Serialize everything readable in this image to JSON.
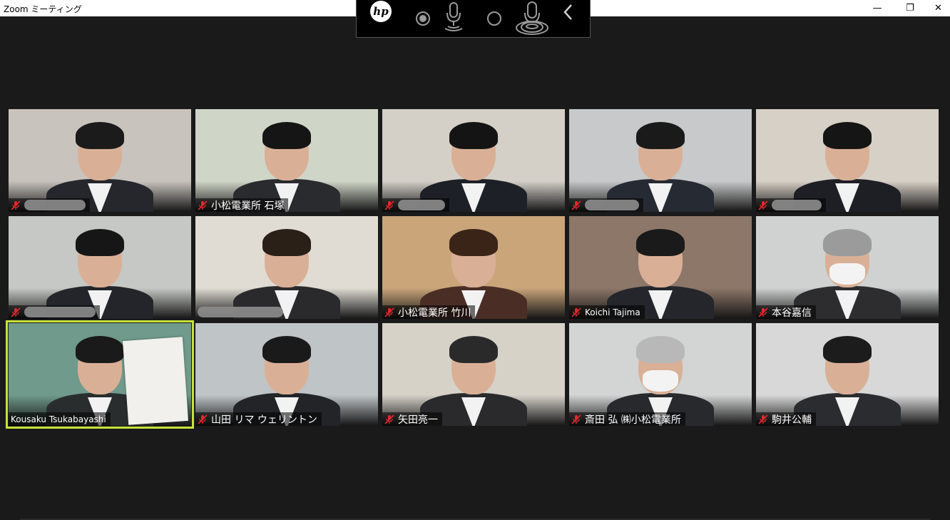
{
  "window": {
    "title": "Zoom ミーティング",
    "minimize_glyph": "—",
    "maximize_glyph": "❐",
    "close_glyph": "✕"
  },
  "hp_toolbar": {
    "logo_text": "hp",
    "buttons": [
      "record-dot-icon",
      "microphone-icon",
      "circle-icon",
      "microphone-broadcast-icon",
      "chevron-left-icon"
    ]
  },
  "participants": [
    {
      "name": "",
      "muted": true,
      "active": false,
      "wall": "#c9c3bd",
      "hair": "#1b1b1b",
      "body": "#25272c"
    },
    {
      "name": "小松電業所 石塚",
      "muted": true,
      "active": false,
      "wall": "#cfd6c8",
      "hair": "#151515",
      "body": "#2a2b2f"
    },
    {
      "name": "",
      "muted": true,
      "active": false,
      "wall": "#d4d0c8",
      "hair": "#141414",
      "body": "#1d2026"
    },
    {
      "name": "",
      "muted": true,
      "active": false,
      "wall": "#c7c9ca",
      "hair": "#1a1a1a",
      "body": "#262a33"
    },
    {
      "name": "",
      "muted": true,
      "active": false,
      "wall": "#d7d0c6",
      "hair": "#151515",
      "body": "#1e1f24"
    },
    {
      "name": "",
      "muted": true,
      "active": false,
      "wall": "#c5c8c4",
      "hair": "#161616",
      "body": "#23252a"
    },
    {
      "name": "",
      "muted": false,
      "active": false,
      "wall": "#e0dcd3",
      "hair": "#2a2018",
      "body": "#2a2a2c"
    },
    {
      "name": "小松電業所 竹川",
      "muted": true,
      "active": false,
      "wall": "#caa57a",
      "hair": "#3a2418",
      "body": "#4a2e26"
    },
    {
      "name": "Koichi Tajima",
      "muted": true,
      "active": false,
      "wall": "#8d7768",
      "hair": "#1a1a1a",
      "body": "#24262b"
    },
    {
      "name": "本谷嘉信",
      "muted": true,
      "active": false,
      "wall": "#cfd2d0",
      "hair": "#9b9b9b",
      "body": "#2d2d30"
    },
    {
      "name": "Kousaku Tsukabayashi",
      "muted": false,
      "active": true,
      "wall": "#6f9a8c",
      "hair": "#1a1a1a",
      "body": "#2a2d2e"
    },
    {
      "name": "山田 リマ ウェリントン",
      "muted": true,
      "active": false,
      "wall": "#bfc4c6",
      "hair": "#1a1a1a",
      "body": "#222428"
    },
    {
      "name": "矢田亮一",
      "muted": true,
      "active": false,
      "wall": "#d6d2c8",
      "hair": "#2a2a2a",
      "body": "#2a2a2c"
    },
    {
      "name": "斎田 弘 ㈱小松電業所",
      "muted": true,
      "active": false,
      "wall": "#d3d4d4",
      "hair": "#b8b8b8",
      "body": "#27292c"
    },
    {
      "name": "駒井公輔",
      "muted": true,
      "active": false,
      "wall": "#d8d8d8",
      "hair": "#1c1c1c",
      "body": "#2b2c2f"
    }
  ],
  "colors": {
    "background": "#1a1a1a",
    "active_border": "#c7e23a",
    "mute_red": "#e0282e"
  }
}
